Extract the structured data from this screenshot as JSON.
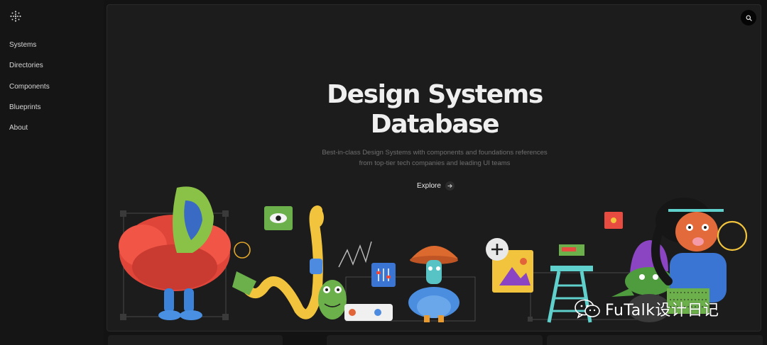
{
  "sidebar": {
    "logo_icon": "sparkle-grid-icon",
    "items": [
      {
        "label": "Systems"
      },
      {
        "label": "Directories"
      },
      {
        "label": "Components"
      },
      {
        "label": "Blueprints"
      },
      {
        "label": "About"
      }
    ]
  },
  "hero": {
    "title_line1": "Design Systems",
    "title_line2": "Database",
    "subtitle_line1": "Best-in-class Design Systems with components and foundations references",
    "subtitle_line2": "from top-tier tech companies and leading UI teams",
    "explore_label": "Explore",
    "search_icon": "search-icon",
    "arrow_icon": "arrow-right-icon"
  },
  "watermark": {
    "text": "FuTalk设计日记",
    "icon": "wechat-icon"
  },
  "colors": {
    "background": "#131313",
    "panel": "#1c1c1c",
    "text": "#efefef",
    "muted": "#6f6f6f"
  }
}
